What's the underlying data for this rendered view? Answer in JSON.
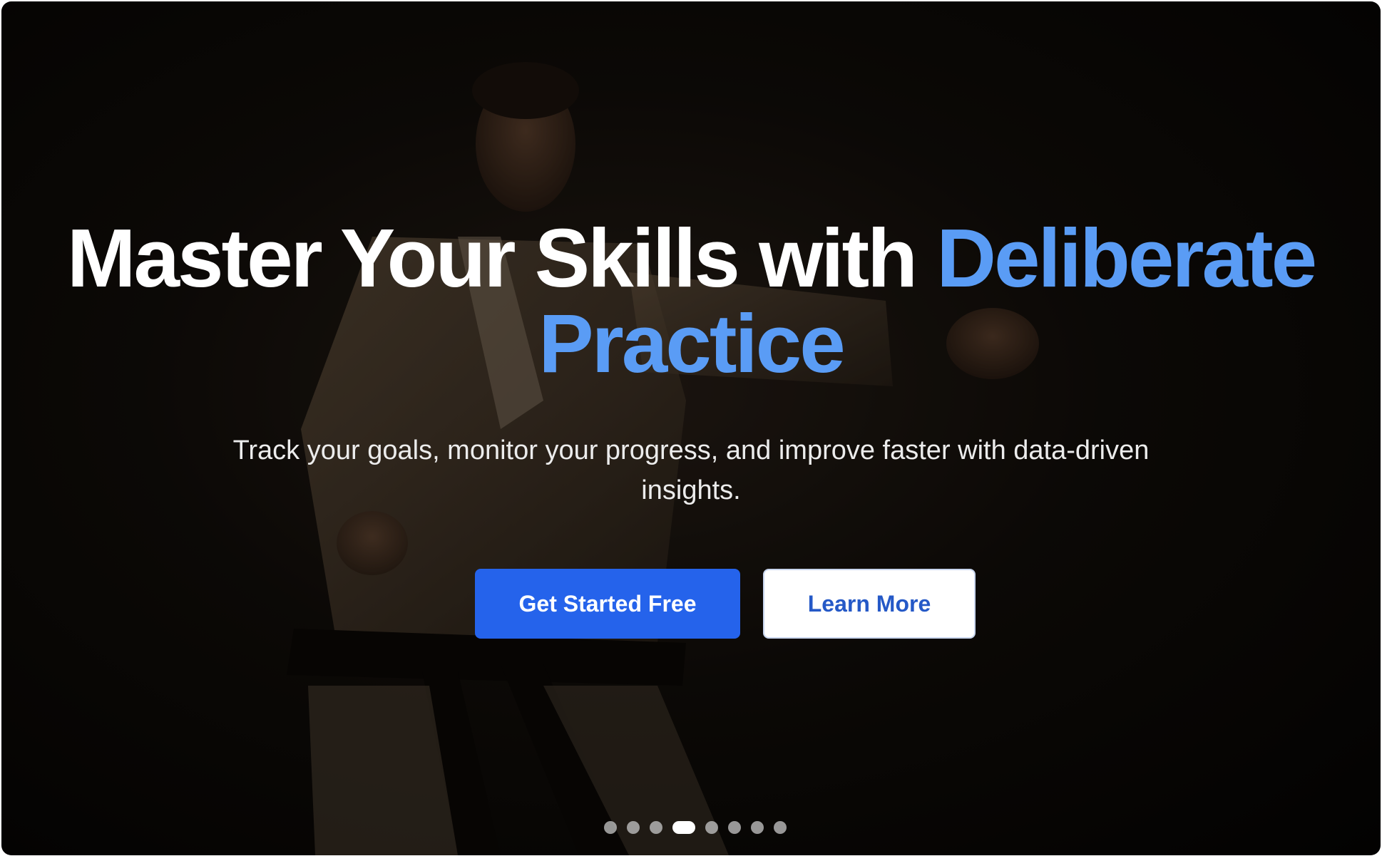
{
  "hero": {
    "headline_main": "Master Your Skills with ",
    "headline_accent": "Deliberate Practice",
    "subtitle": "Track your goals, monitor your progress, and improve faster with data-driven insights.",
    "primary_cta": "Get Started Free",
    "secondary_cta": "Learn More",
    "accent_color": "#5a9cf5",
    "primary_color": "#2563eb",
    "background_image": "karate-practitioner-punch-photo"
  },
  "carousel": {
    "slide_count": 8,
    "active_index": 3
  }
}
